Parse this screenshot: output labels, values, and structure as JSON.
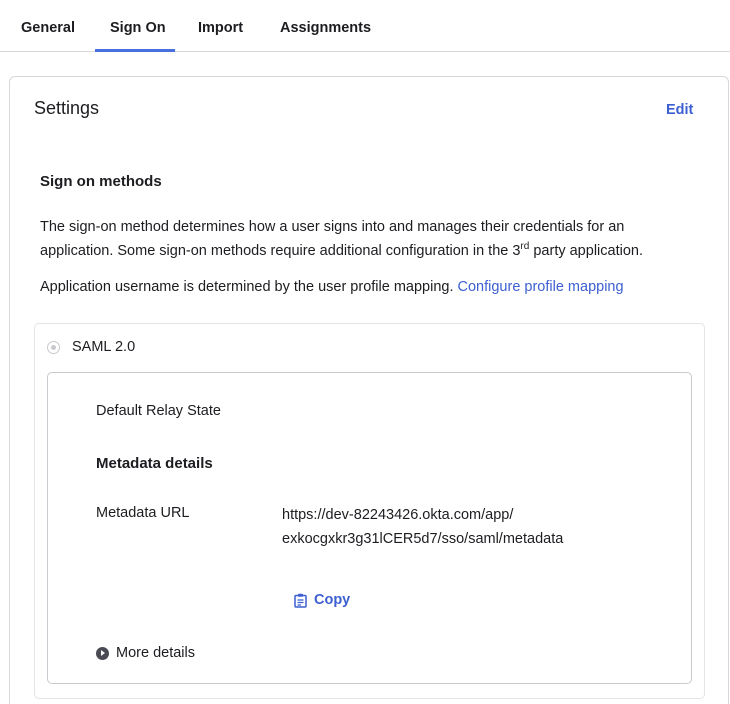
{
  "tabs": [
    {
      "label": "General"
    },
    {
      "label": "Sign On"
    },
    {
      "label": "Import"
    },
    {
      "label": "Assignments"
    }
  ],
  "active_tab": "Sign On",
  "settings": {
    "title": "Settings",
    "edit_label": "Edit"
  },
  "sign_on_methods": {
    "title": "Sign on methods",
    "description_part1": "The sign-on method determines how a user signs into and manages their credentials for an application. Some sign-on methods require additional configuration in the 3",
    "description_sup": "rd",
    "description_part2": " party application.",
    "username_text": "Application username is determined by the user profile mapping. ",
    "username_link": "Configure profile mapping"
  },
  "saml": {
    "label": "SAML 2.0",
    "default_relay_state_label": "Default Relay State",
    "metadata_title": "Metadata details",
    "metadata_url_label": "Metadata URL",
    "metadata_url_value": "https://dev-82243426.okta.com/app/exkocgxkr3g31lCER5d7/sso/saml/metadata",
    "copy_label": "Copy",
    "more_details_label": "More details"
  },
  "colors": {
    "accent": "#3c5fd1",
    "text": "#1d1d21",
    "border": "#d7d7dc"
  }
}
